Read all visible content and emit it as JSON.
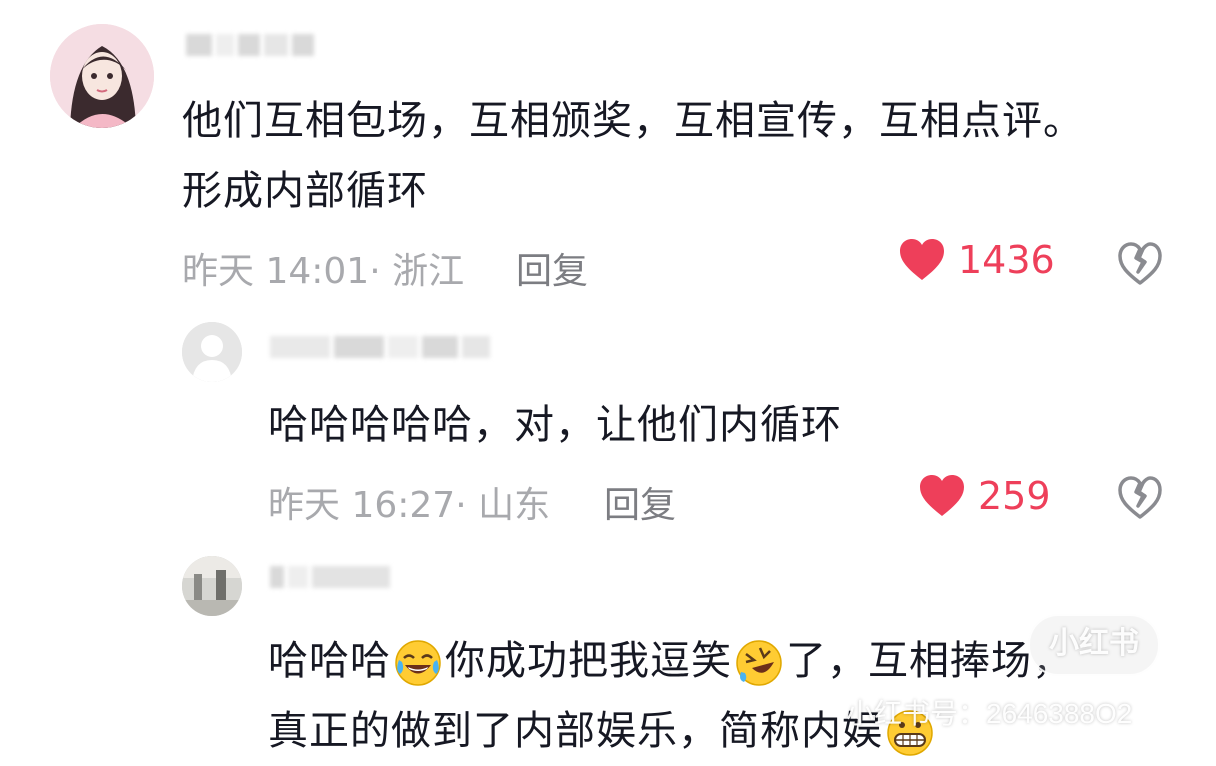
{
  "comments": [
    {
      "text_lines": [
        "他们互相包场，互相颁奖，互相宣传，互相点评。",
        "形成内部循环"
      ],
      "meta": "昨天 14:01· 浙江",
      "reply_label": "回复",
      "likes": "1436"
    },
    {
      "text_lines": [
        "哈哈哈哈哈，对，让他们内循环"
      ],
      "meta": "昨天 16:27· 山东",
      "reply_label": "回复",
      "likes": "259"
    },
    {
      "text_line1_part1": "哈哈哈",
      "text_line1_part2": "你成功把我逗笑",
      "text_line1_part3": "了，互相捧场，",
      "text_line2": "真正的做到了内部娱乐，简称内娱"
    }
  ],
  "watermark": {
    "logo": "小红书",
    "id_text": "小红书号：2646388O2"
  },
  "colors": {
    "like_red": "#ee3f5a",
    "meta_gray": "#a8a9ad",
    "text": "#161823"
  }
}
